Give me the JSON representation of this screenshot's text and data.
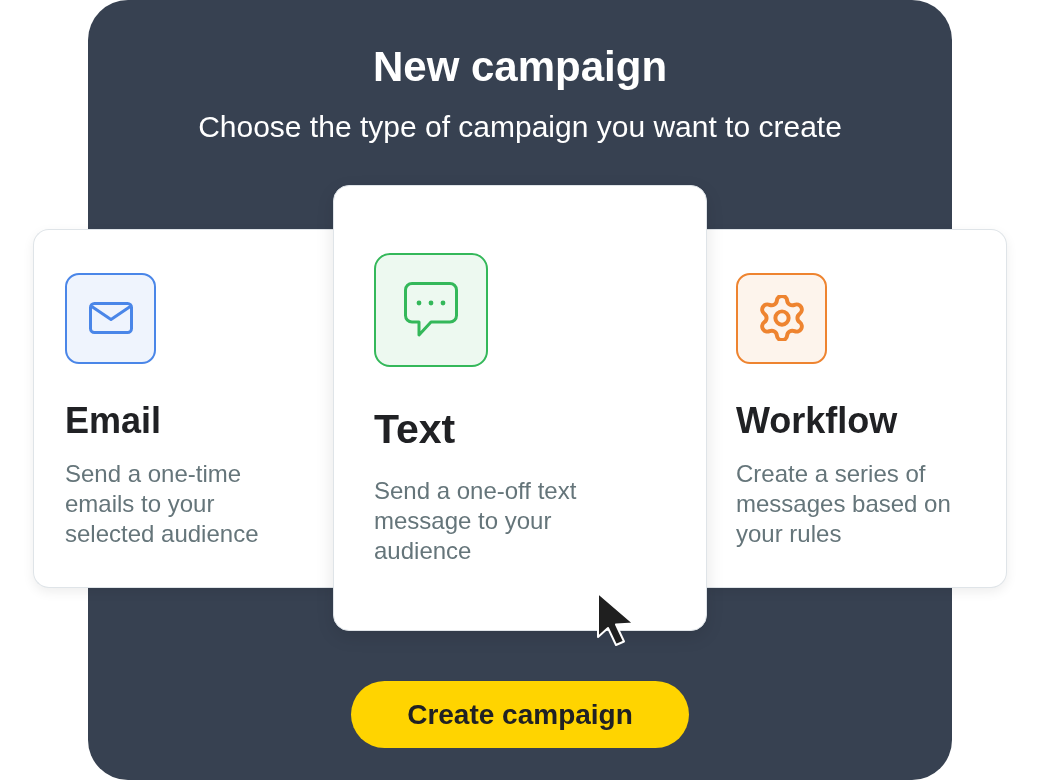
{
  "dialog": {
    "title": "New campaign",
    "subtitle": "Choose the type of campaign you want to create"
  },
  "cards": [
    {
      "kind": "email",
      "title": "Email",
      "description": "Send a one-time emails to your selected audience",
      "color": "#4a86e8",
      "selected": false
    },
    {
      "kind": "text",
      "title": "Text",
      "description": "Send a one-off text message to your audience",
      "color": "#34b85a",
      "selected": true
    },
    {
      "kind": "workflow",
      "title": "Workflow",
      "description": "Create a series of messages based on your rules",
      "color": "#ee8430",
      "selected": false
    }
  ],
  "button": {
    "label": "Create campaign"
  }
}
